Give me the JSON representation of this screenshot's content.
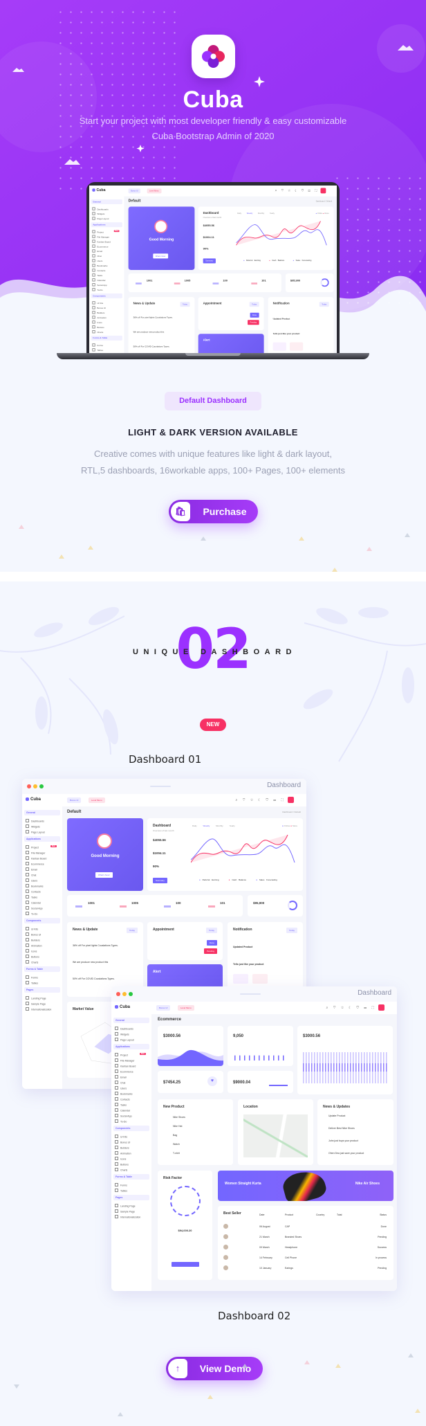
{
  "colors": {
    "brand": "#9b30ff",
    "primary": "#7366ff",
    "secondary": "#f73164",
    "background": "#f4f7fe"
  },
  "hero": {
    "logo_icon": "cuba-logo-icon",
    "app_name": "Cuba",
    "subtitle_line1": "Start your project with most developer friendly & easy customizable",
    "subtitle_line2": "Cuba Bootstrap Admin of 2020"
  },
  "section1": {
    "tag": "Default Dashboard",
    "heading": "LIGHT & DARK VERSION AVAILABLE",
    "desc_line1": "Creative comes with unique features like light & dark layout,",
    "desc_line2": "RTL,5 dashboards, 16workable apps, 100+ Pages, 100+ elements",
    "purchase_label": "Purchase",
    "purchase_icon": "shopping-bag-icon"
  },
  "section2": {
    "number": "02",
    "title_left": "UNIQUE",
    "title_right": "DASHBOARD",
    "badge": "NEW",
    "dashboard1_label": "Dashboard 01",
    "dashboard2_label": "Dashboard 02",
    "view_demo_label": "View Demo",
    "view_demo_icon": "arrow-up-icon"
  },
  "dash1": {
    "window_title": "Dashboard",
    "logo": "Cuba",
    "sidebar": [
      {
        "type": "sec",
        "label": "General"
      },
      {
        "type": "it",
        "label": "Dashboards"
      },
      {
        "type": "it",
        "label": "Widgets"
      },
      {
        "type": "it",
        "label": "Page Layout"
      },
      {
        "type": "sec",
        "label": "Applications"
      },
      {
        "type": "it",
        "label": "Project",
        "badge": "New"
      },
      {
        "type": "it",
        "label": "File Manager"
      },
      {
        "type": "it",
        "label": "Kanban Board"
      },
      {
        "type": "it",
        "label": "Ecommerce"
      },
      {
        "type": "it",
        "label": "Email"
      },
      {
        "type": "it",
        "label": "Chat"
      },
      {
        "type": "it",
        "label": "Users"
      },
      {
        "type": "it",
        "label": "Bookmarks"
      },
      {
        "type": "it",
        "label": "Contacts"
      },
      {
        "type": "it",
        "label": "Tasks"
      },
      {
        "type": "it",
        "label": "Calendar"
      },
      {
        "type": "it",
        "label": "Social App"
      },
      {
        "type": "it",
        "label": "To-Do"
      },
      {
        "type": "sec",
        "label": "Components"
      },
      {
        "type": "it",
        "label": "Ui Kits"
      },
      {
        "type": "it",
        "label": "Bonus UI"
      },
      {
        "type": "it",
        "label": "Builders"
      },
      {
        "type": "it",
        "label": "Animation"
      },
      {
        "type": "it",
        "label": "Icons"
      },
      {
        "type": "it",
        "label": "Buttons"
      },
      {
        "type": "it",
        "label": "Charts"
      },
      {
        "type": "sec",
        "label": "Forms & Table"
      },
      {
        "type": "it",
        "label": "Forms"
      },
      {
        "type": "it",
        "label": "Tables"
      },
      {
        "type": "sec",
        "label": "Pages"
      },
      {
        "type": "it",
        "label": "Landing Page"
      },
      {
        "type": "it",
        "label": "Sample Page"
      },
      {
        "type": "it",
        "label": "Internationalization"
      }
    ],
    "header": {
      "chip1": "Bonus UI",
      "chip2": "Level Menu"
    },
    "page_title": "Default",
    "breadcrumb": "Dashboard / Default",
    "welcome": {
      "greeting": "Good Morning",
      "button": "What's New!"
    },
    "overview": {
      "title": "Dashboard",
      "subtitle": "Overview of last month",
      "stat1": "$4055.56",
      "stat2": "$1004.11",
      "stat3": "90%",
      "button": "Summary",
      "tabs": [
        "Daily",
        "Weekly",
        "Monthly",
        "Yearly"
      ],
      "legend": [
        "Online",
        "Store"
      ],
      "footer": [
        "Referral Earning",
        "Cash Balance",
        "Sales Forecasting"
      ]
    },
    "stats": [
      "1001",
      "1005",
      "100",
      "101"
    ],
    "purchase_value": "$95,900",
    "news_title": "News & Update",
    "news": [
      "36% off For pixel lights Couslations Types.",
      "We are produce new product this",
      "50% off For COVID Couslations Types."
    ],
    "filter": "Today",
    "appointment_title": "Appointment",
    "appointment_buttons": [
      "Done",
      "Pending"
    ],
    "notification_title": "Notification",
    "notifications": [
      "Updated Product",
      "Tello just like your product"
    ],
    "alert_title": "Alert",
    "market_title": "Market Value"
  },
  "dash2": {
    "window_title": "Dashboard",
    "logo": "Cuba",
    "page_title": "Ecommerce",
    "cards": {
      "c1": "$3000.56",
      "c2": "9,050",
      "c3": "$3000.56",
      "c4": "$7454.25",
      "c5": "$9000.04"
    },
    "new_product_title": "New Product",
    "products": [
      "Nike Shoes",
      "Nike Hat",
      "Bag",
      "Watch",
      "T-shirt"
    ],
    "location_title": "Location",
    "news_title": "News & Updates",
    "news": [
      "Update Product",
      "Deliver Best Nike Shoes",
      "John just buys your product",
      "Ohen Dea just save your product"
    ],
    "risk_title": "Risk Factor",
    "risk_cost": "$94,000.20",
    "banner": {
      "left": "Women Straight Kurta",
      "right": "Nike Air Shoes"
    },
    "best_seller_title": "Best Seller",
    "table_headers": [
      "Date",
      "Product",
      "Country",
      "Total",
      "Status"
    ],
    "table_rows": [
      [
        "06 August",
        "CAP",
        "Done"
      ],
      [
        "21 March",
        "Branded Shoes",
        "Pending"
      ],
      [
        "09 March",
        "Headphone",
        "Success"
      ],
      [
        "14 February",
        "Cell Phone",
        "In process"
      ],
      [
        "10 January",
        "Earings",
        "Pending"
      ]
    ]
  }
}
